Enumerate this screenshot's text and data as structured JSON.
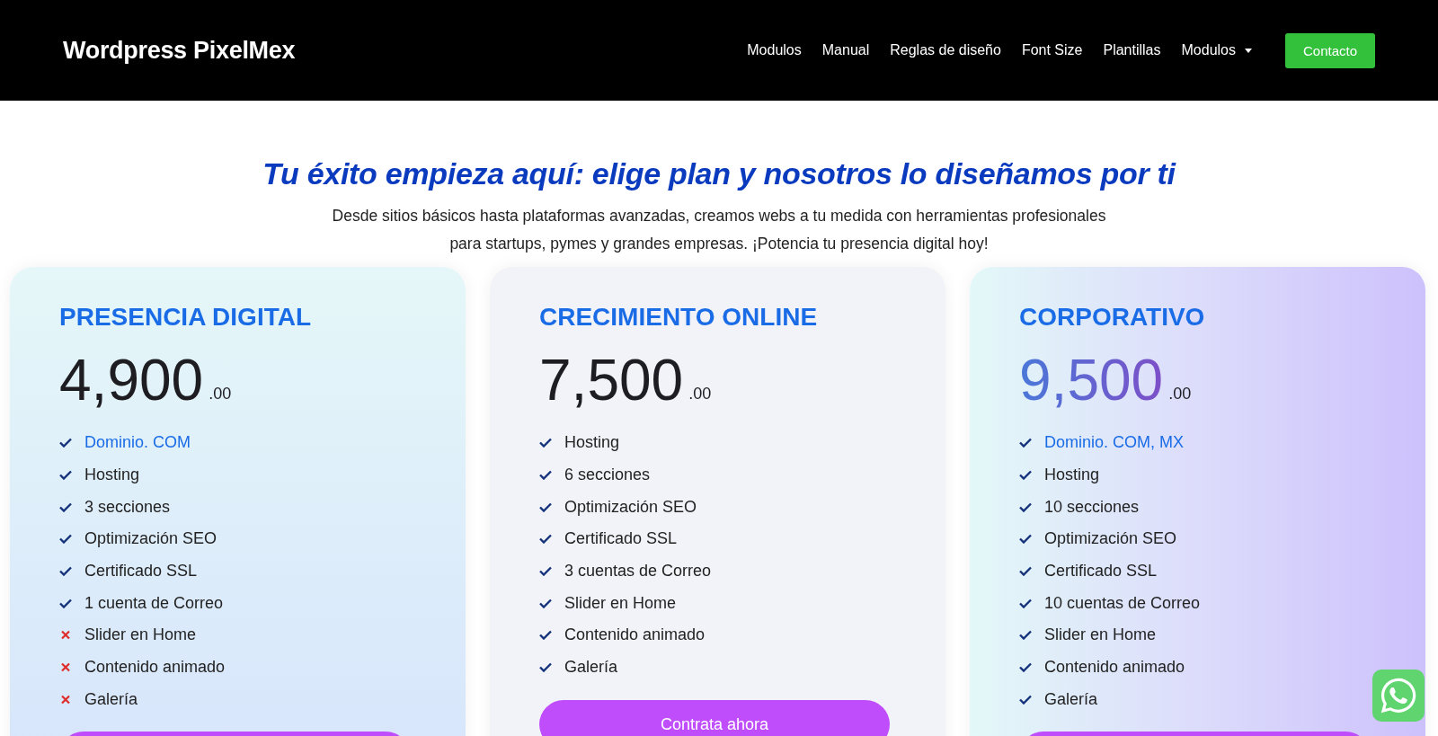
{
  "header": {
    "logo": "Wordpress PixelMex",
    "nav": [
      {
        "label": "Modulos",
        "dropdown": false
      },
      {
        "label": "Manual",
        "dropdown": false
      },
      {
        "label": "Reglas de diseño",
        "dropdown": false
      },
      {
        "label": "Font Size",
        "dropdown": false
      },
      {
        "label": "Plantillas",
        "dropdown": false
      },
      {
        "label": "Modulos",
        "dropdown": true
      }
    ],
    "cta": "Contacto"
  },
  "hero": {
    "title": "Tu éxito empieza aquí: elige plan y nosotros lo diseñamos por ti",
    "subtitle": [
      "Desde sitios básicos hasta plataformas avanzadas, creamos webs a tu medida con herramientas profesionales",
      "para startups, pymes y grandes empresas. ¡Potencia tu presencia digital hoy!"
    ]
  },
  "plans": [
    {
      "kind": "vertical",
      "name": "PRESENCIA DIGITAL",
      "price": "4,900",
      "cents": ".00",
      "gradient_price": false,
      "features": [
        {
          "kind": "check",
          "text": "Dominio. COM",
          "accent": true
        },
        {
          "kind": "check",
          "text": "Hosting",
          "accent": false
        },
        {
          "kind": "check",
          "text": "3 secciones",
          "accent": false
        },
        {
          "kind": "check",
          "text": "Optimización SEO",
          "accent": false
        },
        {
          "kind": "check",
          "text": "Certificado SSL",
          "accent": false
        },
        {
          "kind": "check",
          "text": "1 cuenta de Correo",
          "accent": false
        },
        {
          "kind": "cross",
          "text": "Slider en Home",
          "accent": false
        },
        {
          "kind": "cross",
          "text": "Contenido animado",
          "accent": false
        },
        {
          "kind": "cross",
          "text": "Galería",
          "accent": false
        }
      ],
      "has_button": true
    },
    {
      "kind": "plain",
      "name": "CRECIMIENTO ONLINE",
      "price": "7,500",
      "cents": ".00",
      "gradient_price": false,
      "features": [
        {
          "kind": "check",
          "text": "Hosting",
          "accent": false
        },
        {
          "kind": "check",
          "text": "6 secciones",
          "accent": false
        },
        {
          "kind": "check",
          "text": "Optimización SEO",
          "accent": false
        },
        {
          "kind": "check",
          "text": "Certificado SSL",
          "accent": false
        },
        {
          "kind": "check",
          "text": "3 cuentas de Correo",
          "accent": false
        },
        {
          "kind": "check",
          "text": "Slider en Home",
          "accent": false
        },
        {
          "kind": "check",
          "text": "Contenido animado",
          "accent": false
        },
        {
          "kind": "check",
          "text": "Galería",
          "accent": false
        }
      ],
      "has_button": true,
      "button_label": "Contrata ahora"
    },
    {
      "kind": "horizontal",
      "name": "CORPORATIVO",
      "price": "9,500",
      "cents": ".00",
      "gradient_price": true,
      "features": [
        {
          "kind": "check",
          "text": "Dominio. COM, MX",
          "accent": true
        },
        {
          "kind": "check",
          "text": "Hosting",
          "accent": false
        },
        {
          "kind": "check",
          "text": "10 secciones",
          "accent": false
        },
        {
          "kind": "check",
          "text": "Optimización SEO",
          "accent": false
        },
        {
          "kind": "check",
          "text": "Certificado SSL",
          "accent": false
        },
        {
          "kind": "check",
          "text": "10 cuentas de Correo",
          "accent": false
        },
        {
          "kind": "check",
          "text": "Slider en Home",
          "accent": false
        },
        {
          "kind": "check",
          "text": "Contenido animado",
          "accent": false
        },
        {
          "kind": "check",
          "text": "Galería",
          "accent": false
        }
      ],
      "has_button": true
    }
  ]
}
